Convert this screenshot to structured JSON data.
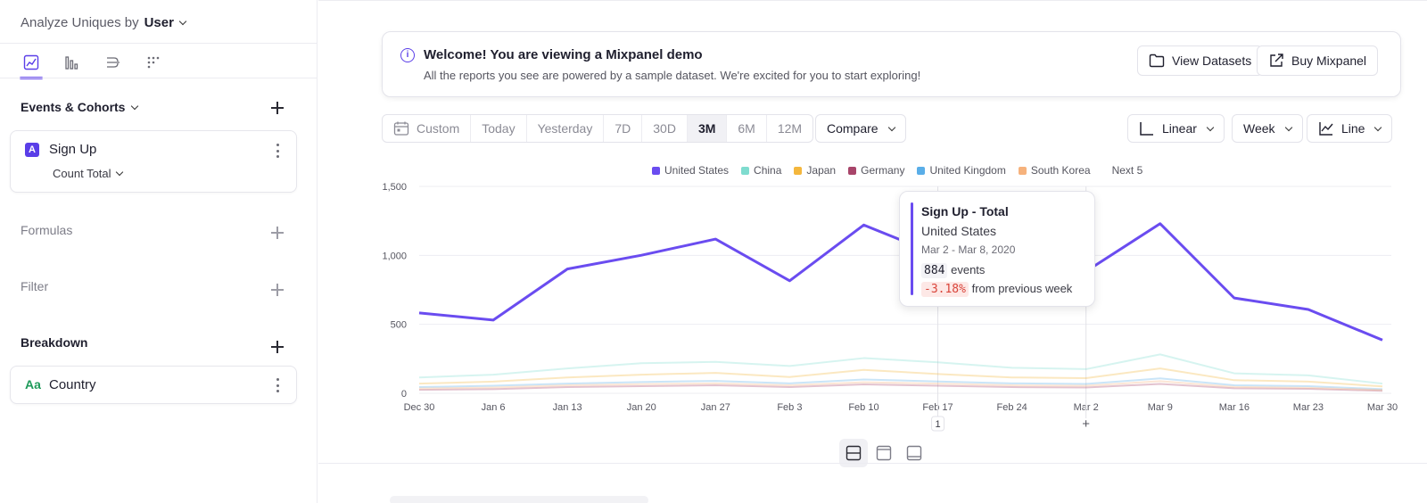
{
  "sidebar": {
    "analyze_label": "Analyze Uniques by",
    "analyze_value": "User",
    "report_tabs": [
      {
        "name": "insights",
        "icon": "line-chart-icon",
        "active": true
      },
      {
        "name": "funnels",
        "icon": "bar-columns-icon",
        "active": false
      },
      {
        "name": "flows",
        "icon": "flows-icon",
        "active": false
      },
      {
        "name": "retention",
        "icon": "dots-grid-icon",
        "active": false
      }
    ],
    "events_title": "Events & Cohorts",
    "event": {
      "badge": "A",
      "name": "Sign Up",
      "measure": "Count Total"
    },
    "formulas_title": "Formulas",
    "filter_title": "Filter",
    "breakdown_title": "Breakdown",
    "breakdown": {
      "badge": "Aa",
      "name": "Country"
    }
  },
  "banner": {
    "title": "Welcome! You are viewing a Mixpanel demo",
    "subtitle": "All the reports you see are powered by a sample dataset. We're excited for you to start exploring!",
    "view_datasets": "View Datasets",
    "buy": "Buy Mixpanel"
  },
  "date_range": {
    "custom": "Custom",
    "options": [
      "Today",
      "Yesterday",
      "7D",
      "30D",
      "3M",
      "6M",
      "12M"
    ],
    "active": "3M"
  },
  "controls": {
    "compare": "Compare",
    "scale": "Linear",
    "interval": "Week",
    "chart_type": "Line"
  },
  "legend": {
    "items": [
      {
        "label": "United States",
        "color": "#6a4cf0"
      },
      {
        "label": "China",
        "color": "#7fdccf"
      },
      {
        "label": "Japan",
        "color": "#f4b73d"
      },
      {
        "label": "Germany",
        "color": "#a8456a"
      },
      {
        "label": "United Kingdom",
        "color": "#5aaee8"
      },
      {
        "label": "South Korea",
        "color": "#f6b27c"
      }
    ],
    "next": "Next 5"
  },
  "tooltip": {
    "title": "Sign Up - Total",
    "series": "United States",
    "date": "Mar 2 - Mar 8, 2020",
    "events_value": "884",
    "events_label": "events",
    "change": "-3.18%",
    "change_label": "from previous week"
  },
  "markers": {
    "annotation_count": "1",
    "add": "+"
  },
  "chart_data": {
    "type": "line",
    "x": [
      "Dec 30",
      "Jan 6",
      "Jan 13",
      "Jan 20",
      "Jan 27",
      "Feb 3",
      "Feb 10",
      "Feb 17",
      "Feb 24",
      "Mar 2",
      "Mar 9",
      "Mar 16",
      "Mar 23",
      "Mar 30"
    ],
    "ylim": [
      0,
      1500
    ],
    "y_ticks": [
      "0",
      "500",
      "1,000",
      "1,500"
    ],
    "grid": true,
    "legend_position": "top",
    "series": [
      {
        "name": "United States",
        "color": "#6a4cf0",
        "values": [
          583,
          531,
          901,
          1001,
          1118,
          816,
          1220,
          1004,
          942,
          884,
          1230,
          691,
          608,
          386
        ]
      },
      {
        "name": "China",
        "color": "#7fdccf",
        "values": [
          115,
          135,
          180,
          218,
          228,
          198,
          255,
          225,
          185,
          175,
          282,
          145,
          130,
          70
        ]
      },
      {
        "name": "Japan",
        "color": "#f4b73d",
        "values": [
          70,
          85,
          115,
          135,
          148,
          118,
          170,
          140,
          115,
          110,
          180,
          95,
          85,
          50
        ]
      },
      {
        "name": "Germany",
        "color": "#a8456a",
        "values": [
          25,
          30,
          45,
          52,
          58,
          45,
          65,
          55,
          45,
          42,
          68,
          36,
          32,
          18
        ]
      },
      {
        "name": "United Kingdom",
        "color": "#5aaee8",
        "values": [
          45,
          55,
          70,
          82,
          90,
          72,
          100,
          86,
          72,
          68,
          108,
          58,
          52,
          30
        ]
      },
      {
        "name": "South Korea",
        "color": "#f6b27c",
        "values": [
          35,
          42,
          58,
          66,
          72,
          58,
          80,
          70,
          58,
          55,
          88,
          46,
          40,
          24
        ]
      }
    ]
  }
}
